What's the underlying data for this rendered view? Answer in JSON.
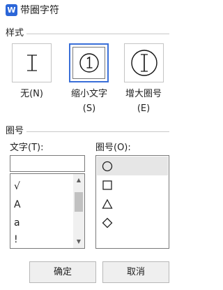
{
  "window": {
    "title": "带圈字符",
    "app_logo": "W",
    "app_icon": "wps-writer-icon"
  },
  "style_section": {
    "heading": "样式",
    "options": [
      {
        "label": "无(N)",
        "glyph": "I",
        "selected": false
      },
      {
        "label": "缩小文字(S)",
        "glyph": "①",
        "selected": true
      },
      {
        "label": "增大圈号(E)",
        "glyph": "①",
        "selected": false
      }
    ]
  },
  "enclosure_section": {
    "heading": "圈号",
    "text_label": "文字(T):",
    "text_value": "",
    "text_options": [
      "√",
      "A",
      "a",
      "!"
    ],
    "enclosure_label": "圈号(O):",
    "enclosure_options": [
      "circle",
      "square",
      "triangle",
      "diamond"
    ],
    "selected_enclosure": "circle"
  },
  "buttons": {
    "ok": "确定",
    "cancel": "取消"
  },
  "colors": {
    "accent": "#3a6fd8",
    "logo": "#2b66d8"
  }
}
